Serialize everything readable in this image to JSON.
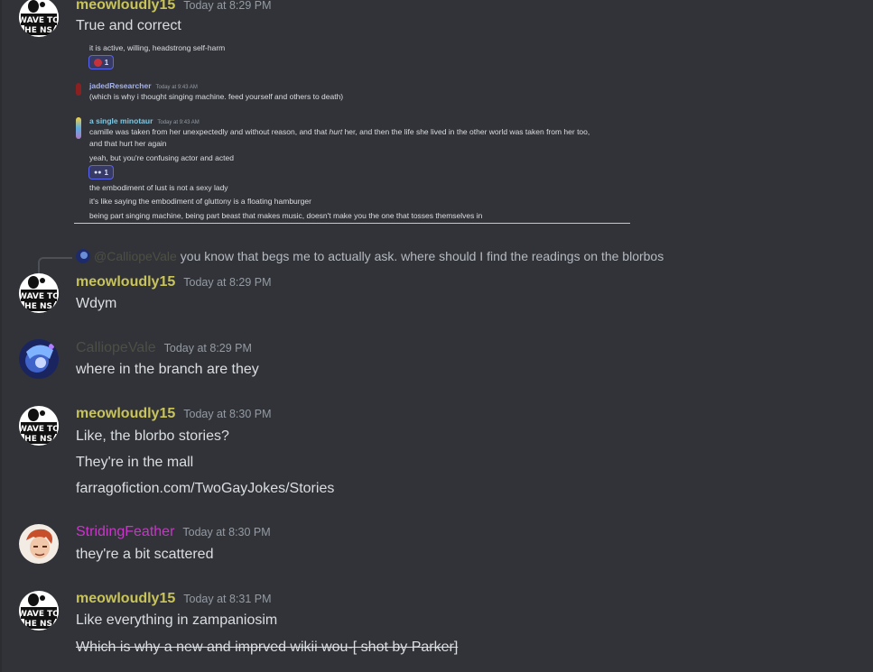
{
  "colors": {
    "background": "#313338",
    "meowloudly": "#c9c45a",
    "calliope": "#4d4f45",
    "striding": "#c837c8",
    "jaded": "#a6b3e8",
    "minotaur": "#7ec8e3"
  },
  "messages": [
    {
      "user": "meowloudly15",
      "time": "Today at 8:29 PM",
      "lines": [
        "True and correct"
      ],
      "avatar": "wave-to-the-nsa-avatar",
      "avatar_text": [
        "WAVE TO",
        "THE NSA"
      ]
    },
    {
      "user": "meowloudly15",
      "time": "Today at 8:29 PM",
      "lines": [
        "Wdym"
      ],
      "avatar": "wave-to-the-nsa-avatar",
      "avatar_text": [
        "WAVE TO",
        "THE NSA"
      ]
    },
    {
      "user": "CalliopeVale",
      "time": "Today at 8:29 PM",
      "lines": [
        "where in the branch are they"
      ],
      "avatar": "calliope-avatar"
    },
    {
      "user": "meowloudly15",
      "time": "Today at 8:30 PM",
      "lines": [
        "Like, the blorbo stories?",
        "They're in the mall",
        "farragofiction.com/TwoGayJokes/Stories"
      ],
      "avatar": "wave-to-the-nsa-avatar",
      "avatar_text": [
        "WAVE TO",
        "THE NSA"
      ]
    },
    {
      "user": "StridingFeather",
      "time": "Today at 8:30 PM",
      "lines": [
        "they're a bit scattered"
      ],
      "avatar": "striding-feather-avatar"
    },
    {
      "user": "meowloudly15",
      "time": "Today at 8:31 PM",
      "lines": [
        "Like everything in zampaniosim",
        "Which is why a new and imprved wikii wou-[ shot by Parker]"
      ],
      "avatar": "wave-to-the-nsa-avatar",
      "avatar_text": [
        "WAVE TO",
        "THE NSA"
      ]
    }
  ],
  "reply": {
    "name": "@CalliopeVale",
    "text": "you know that begs me to actually ask. where should I find the readings on the blorbos"
  },
  "embed": {
    "line1": "it is active, willing, headstrong self-harm",
    "react1_count": "1",
    "user2": "jadedResearcher",
    "time2": "Today at 9:43 AM",
    "line2": "(which is why i thought singing machine. feed yourself and others to death)",
    "user3": "a single minotaur",
    "time3": "Today at 9:43 AM",
    "line3a_pre": "camille was taken from her unexpectedly and without reason, and that ",
    "line3a_em": "hurt",
    "line3a_post": " her, and then the life she lived in the other world was taken from her too,",
    "line3b": "and that hurt her again",
    "line3c": "yeah, but you're confusing actor and acted",
    "react2_count": "1",
    "line3d": "the embodiment of lust is not a sexy lady",
    "line3e": "it's like saying the embodiment of gluttony is a floating hamburger",
    "line3f": "being part singing machine, being part beast that makes music, doesn't make you the one that tosses themselves in"
  }
}
